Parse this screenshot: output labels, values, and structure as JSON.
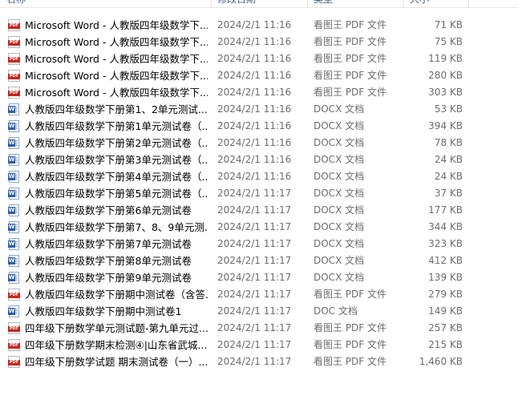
{
  "columns": {
    "name": "名称",
    "date": "修改日期",
    "type": "类型",
    "size": "大小"
  },
  "files": [
    {
      "name": "Microsoft Word - 人教版四年级数学下...",
      "date": "2024/2/1 11:16",
      "type": "看图王 PDF 文件",
      "size": "71 KB",
      "icon": "pdf-icon"
    },
    {
      "name": "Microsoft Word - 人教版四年级数学下...",
      "date": "2024/2/1 11:16",
      "type": "看图王 PDF 文件",
      "size": "75 KB",
      "icon": "pdf-icon"
    },
    {
      "name": "Microsoft Word - 人教版四年级数学下...",
      "date": "2024/2/1 11:16",
      "type": "看图王 PDF 文件",
      "size": "119 KB",
      "icon": "pdf-icon"
    },
    {
      "name": "Microsoft Word - 人教版四年级数学下...",
      "date": "2024/2/1 11:16",
      "type": "看图王 PDF 文件",
      "size": "280 KB",
      "icon": "pdf-icon"
    },
    {
      "name": "Microsoft Word - 人教版四年级数学下...",
      "date": "2024/2/1 11:16",
      "type": "看图王 PDF 文件",
      "size": "303 KB",
      "icon": "pdf-icon"
    },
    {
      "name": "人教版四年级数学下册第1、2单元测试...",
      "date": "2024/2/1 11:16",
      "type": "DOCX 文档",
      "size": "53 KB",
      "icon": "word-icon"
    },
    {
      "name": "人教版四年级数学下册第1单元测试卷（...",
      "date": "2024/2/1 11:16",
      "type": "DOCX 文档",
      "size": "394 KB",
      "icon": "word-icon"
    },
    {
      "name": "人教版四年级数学下册第2单元测试卷（...",
      "date": "2024/2/1 11:16",
      "type": "DOCX 文档",
      "size": "78 KB",
      "icon": "word-icon"
    },
    {
      "name": "人教版四年级数学下册第3单元测试卷（...",
      "date": "2024/2/1 11:16",
      "type": "DOCX 文档",
      "size": "24 KB",
      "icon": "word-icon"
    },
    {
      "name": "人教版四年级数学下册第4单元测试卷（...",
      "date": "2024/2/1 11:16",
      "type": "DOCX 文档",
      "size": "24 KB",
      "icon": "word-icon"
    },
    {
      "name": "人教版四年级数学下册第5单元测试卷（...",
      "date": "2024/2/1 11:17",
      "type": "DOCX 文档",
      "size": "37 KB",
      "icon": "word-icon"
    },
    {
      "name": "人教版四年级数学下册第6单元测试卷",
      "date": "2024/2/1 11:17",
      "type": "DOCX 文档",
      "size": "177 KB",
      "icon": "word-icon"
    },
    {
      "name": "人教版四年级数学下册第7、8、9单元测...",
      "date": "2024/2/1 11:17",
      "type": "DOCX 文档",
      "size": "344 KB",
      "icon": "word-icon"
    },
    {
      "name": "人教版四年级数学下册第7单元测试卷",
      "date": "2024/2/1 11:17",
      "type": "DOCX 文档",
      "size": "323 KB",
      "icon": "word-icon"
    },
    {
      "name": "人教版四年级数学下册第8单元测试卷",
      "date": "2024/2/1 11:17",
      "type": "DOCX 文档",
      "size": "412 KB",
      "icon": "word-icon"
    },
    {
      "name": "人教版四年级数学下册第9单元测试卷",
      "date": "2024/2/1 11:17",
      "type": "DOCX 文档",
      "size": "139 KB",
      "icon": "word-icon"
    },
    {
      "name": "人教版四年级数学下册期中测试卷（含答...",
      "date": "2024/2/1 11:17",
      "type": "看图王 PDF 文件",
      "size": "279 KB",
      "icon": "pdf-icon"
    },
    {
      "name": "人教版四年级数学下册期中测试卷1",
      "date": "2024/2/1 11:17",
      "type": "DOC 文档",
      "size": "149 KB",
      "icon": "word-icon"
    },
    {
      "name": "四年级下册数学单元测试题-第九单元过...",
      "date": "2024/2/1 11:17",
      "type": "看图王 PDF 文件",
      "size": "257 KB",
      "icon": "pdf-icon"
    },
    {
      "name": "四年级下册数学期末检测④|山东省武城...",
      "date": "2024/2/1 11:17",
      "type": "看图王 PDF 文件",
      "size": "215 KB",
      "icon": "pdf-icon"
    },
    {
      "name": "四年级下册数学试题 期末测试卷（一）...",
      "date": "2024/2/1 11:17",
      "type": "看图王 PDF 文件",
      "size": "1,460 KB",
      "icon": "pdf-icon"
    }
  ],
  "icon_labels": {
    "pdf": "PDF",
    "word": "W"
  },
  "colors": {
    "pdf_red": "#c8261f",
    "word_blue": "#2b5fb4",
    "header_text": "#4c607a",
    "secondary_text": "#6d6d6d"
  }
}
